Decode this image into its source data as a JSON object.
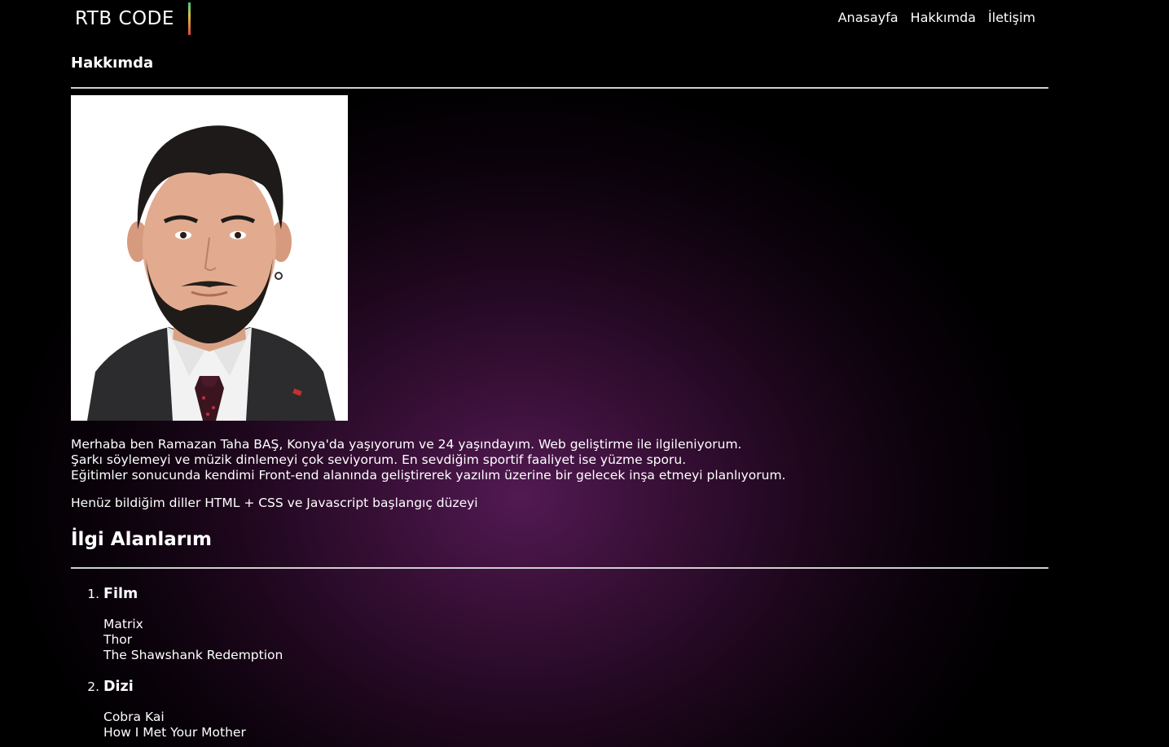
{
  "header": {
    "logo": "RTB CODE",
    "nav": [
      "Anasayfa",
      "Hakkımda",
      "İletişim"
    ]
  },
  "page_title": "Hakkımda",
  "bio": {
    "line1": "Merhaba ben Ramazan Taha BAŞ, Konya'da yaşıyorum ve 24 yaşındayım. Web geliştirme ile ilgileniyorum.",
    "line2": "Şarkı söylemeyi ve müzik dinlemeyi çok seviyorum. En sevdiğim sportif faaliyet ise yüzme sporu.",
    "line3": "Eğitimler sonucunda kendimi Front-end alanında geliştirerek yazılım üzerine bir gelecek inşa etmeyi planlıyorum."
  },
  "languages": "Henüz bildiğim diller HTML + CSS ve Javascript başlangıç düzeyi",
  "interests": {
    "title": "İlgi Alanlarım",
    "categories": [
      {
        "title": "Film",
        "items": [
          "Matrix",
          "Thor",
          "The Shawshank Redemption"
        ]
      },
      {
        "title": "Dizi",
        "items": [
          "Cobra Kai",
          "How I Met Your Mother"
        ]
      }
    ]
  },
  "colors": {
    "background": "#000000",
    "glow": "#521a52",
    "text": "#ffffff",
    "divider": "#cfcfcf"
  }
}
